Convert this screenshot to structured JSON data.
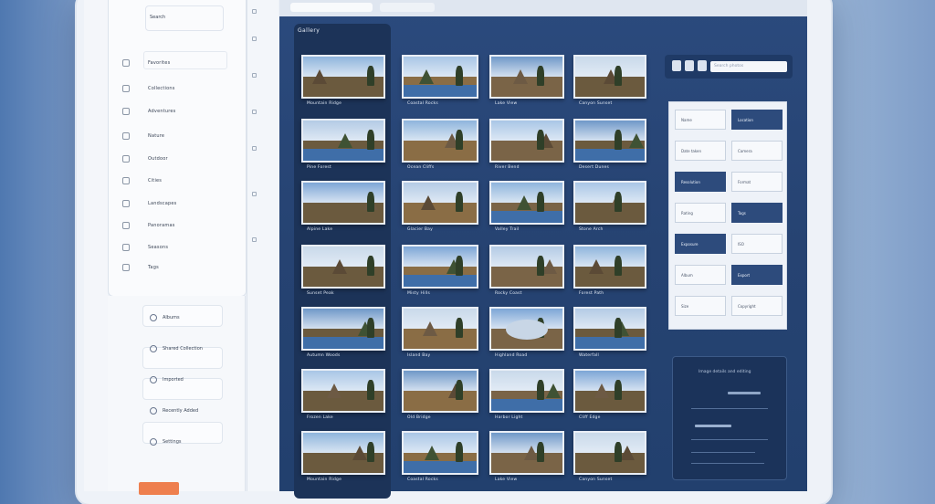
{
  "sidebar": {
    "search_label": "Search",
    "items": [
      {
        "label": "Favorites",
        "icon": "star-icon"
      },
      {
        "label": "Collections",
        "icon": "folder-icon"
      },
      {
        "label": "Adventures",
        "icon": "compass-icon"
      },
      {
        "label": "Nature",
        "icon": "leaf-icon"
      },
      {
        "label": "Outdoor",
        "icon": "mountain-icon"
      },
      {
        "label": "Cities",
        "icon": "building-icon"
      },
      {
        "label": "Landscapes",
        "icon": "image-icon"
      },
      {
        "label": "Panoramas",
        "icon": "panorama-icon"
      },
      {
        "label": "Seasons",
        "icon": "calendar-icon"
      },
      {
        "label": "Tags",
        "icon": "tag-icon"
      }
    ]
  },
  "lower_panel": {
    "rows": [
      {
        "label": "Albums"
      },
      {
        "label": "Shared Collection"
      },
      {
        "label": "Imported"
      },
      {
        "label": "Recently Added"
      },
      {
        "label": "Settings"
      }
    ]
  },
  "gallery": {
    "title": "Gallery",
    "captions": [
      "Mountain Ridge",
      "Coastal Rocks",
      "Lake View",
      "Canyon Sunset",
      "Pine Forest",
      "Ocean Cliffs",
      "River Bend",
      "Desert Dunes",
      "Alpine Lake",
      "Glacier Bay",
      "Valley Trail",
      "Stone Arch",
      "Sunset Peak",
      "Misty Hills",
      "Rocky Coast",
      "Forest Path",
      "Autumn Woods",
      "Island Bay",
      "Highland Road",
      "Waterfall",
      "Frozen Lake",
      "Old Bridge",
      "Harbor Light",
      "Cliff Edge"
    ]
  },
  "toolbar": {
    "search_placeholder": "Search photos"
  },
  "form": {
    "rows": [
      {
        "left": "Name",
        "right": "Location",
        "left_dark": false,
        "right_dark": true
      },
      {
        "left": "Date taken",
        "right": "Camera",
        "left_dark": false,
        "right_dark": false
      },
      {
        "left": "Resolution",
        "right": "Format",
        "left_dark": true,
        "right_dark": false
      },
      {
        "left": "Rating",
        "right": "Tags",
        "left_dark": false,
        "right_dark": true
      },
      {
        "left": "Exposure",
        "right": "ISO",
        "left_dark": true,
        "right_dark": false
      },
      {
        "left": "Album",
        "right": "Export",
        "left_dark": false,
        "right_dark": true
      },
      {
        "left": "Size",
        "right": "Copyright",
        "left_dark": false,
        "right_dark": false
      }
    ]
  },
  "info_panel": {
    "title": "Image details and editing"
  },
  "colors": {
    "accent_orange": "#ee7f4e",
    "main_bg": "#264372",
    "form_dark": "#2d4b7c"
  }
}
